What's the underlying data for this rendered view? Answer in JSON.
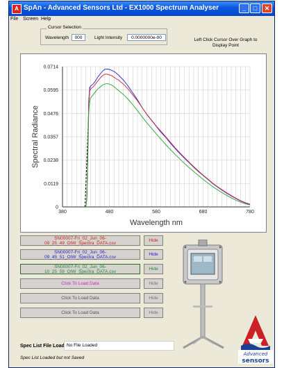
{
  "window": {
    "title": "SpAn - Advanced Sensors Ltd - EX1000 Spectrum Analyser",
    "app_icon_glyph": "A",
    "minimize_glyph": "_",
    "maximize_glyph": "□",
    "close_glyph": "✕",
    "titlebar_color": "#0b56df"
  },
  "menu": {
    "items": [
      "File",
      "Screen",
      "Help"
    ]
  },
  "cursor": {
    "group_label": "Cursor Selection",
    "wavelength_label": "Wavelength",
    "wavelength_value": "000",
    "intensity_label": "Light Intensity",
    "intensity_value": "0.0000000e-00",
    "hint": "Left Click Cursor Over Graph to Display Point"
  },
  "chart_data": {
    "type": "line",
    "xlabel": "Wavelength nm",
    "ylabel": "Spectral Radiance",
    "xlim": [
      380,
      780
    ],
    "ylim": [
      0,
      0.0714
    ],
    "x_ticks": [
      380,
      480,
      580,
      680,
      780
    ],
    "x_tick_labels": [
      "380",
      "480",
      "580",
      "680",
      "780"
    ],
    "y_ticks": [
      0,
      0.0119,
      0.0238,
      0.0357,
      0.0476,
      0.0595,
      0.0714
    ],
    "y_tick_labels": [
      "0",
      "0.0119",
      "0.0238",
      "0.0357",
      "0.0476",
      "0.0595",
      "0.0714"
    ],
    "grid": true,
    "x": [
      430,
      432,
      434,
      436,
      438,
      440,
      445,
      450,
      455,
      460,
      465,
      470,
      475,
      480,
      485,
      490,
      495,
      500,
      510,
      520,
      530,
      540,
      550,
      560,
      570,
      580,
      590,
      600,
      610,
      620,
      630,
      640,
      650,
      660,
      670,
      680,
      690,
      700,
      710,
      720,
      730,
      740,
      750,
      760,
      770,
      780
    ],
    "series": [
      {
        "color": "#3333cc",
        "values": [
          0.0,
          0.005,
          0.03,
          0.054,
          0.0605,
          0.0615,
          0.0625,
          0.064,
          0.066,
          0.0675,
          0.069,
          0.07,
          0.0702,
          0.07,
          0.0695,
          0.069,
          0.068,
          0.067,
          0.0645,
          0.0615,
          0.058,
          0.0545,
          0.0505,
          0.047,
          0.044,
          0.041,
          0.038,
          0.0355,
          0.0325,
          0.0298,
          0.0272,
          0.0248,
          0.0225,
          0.0202,
          0.018,
          0.016,
          0.014,
          0.012,
          0.0102,
          0.0086,
          0.007,
          0.0056,
          0.0042,
          0.003,
          0.002,
          0.0012
        ]
      },
      {
        "color": "#cc3344",
        "values": [
          0.0,
          0.005,
          0.029,
          0.053,
          0.059,
          0.06,
          0.061,
          0.0625,
          0.064,
          0.0655,
          0.0668,
          0.0675,
          0.0676,
          0.0672,
          0.0668,
          0.066,
          0.0652,
          0.0645,
          0.0625,
          0.06,
          0.057,
          0.054,
          0.0505,
          0.0472,
          0.0442,
          0.0412,
          0.0385,
          0.0358,
          0.033,
          0.0302,
          0.0276,
          0.0252,
          0.0228,
          0.0205,
          0.0183,
          0.0162,
          0.0142,
          0.0122,
          0.0104,
          0.0088,
          0.0072,
          0.0058,
          0.0044,
          0.0032,
          0.0022,
          0.0014
        ]
      },
      {
        "color": "#33aa44",
        "values": [
          0.0,
          0.004,
          0.025,
          0.048,
          0.054,
          0.0555,
          0.057,
          0.0585,
          0.06,
          0.061,
          0.062,
          0.0625,
          0.0628,
          0.0625,
          0.062,
          0.0612,
          0.0602,
          0.0592,
          0.0572,
          0.0548,
          0.052,
          0.049,
          0.0458,
          0.0428,
          0.04,
          0.0372,
          0.0345,
          0.0318,
          0.0292,
          0.0268,
          0.0245,
          0.0222,
          0.02,
          0.018,
          0.016,
          0.014,
          0.0122,
          0.0104,
          0.0088,
          0.0073,
          0.0059,
          0.0046,
          0.0034,
          0.0024,
          0.0016,
          0.001
        ]
      }
    ],
    "dashed_segment": {
      "x": [
        428,
        438
      ],
      "y": [
        0.0,
        0.061
      ],
      "color": "#111111"
    }
  },
  "files": [
    {
      "line1": "SN00007-Fri_02_Jun_06-",
      "line2": "09_25_49_OIW_Spectra_DATA.csv",
      "color": "#cc2222",
      "hide_label": "Hide",
      "hide_color": "#cc2222"
    },
    {
      "line1": "SN00007-Fri_02_Jun_06-",
      "line2": "09_45_51_OIW_Spectra_DATA.csv",
      "color": "#2222cc",
      "hide_label": "Hide",
      "hide_color": "#2222cc"
    },
    {
      "line1": "SN00007-Fri_02_Jun_06-",
      "line2": "10_25_59_OIW_Spectra_DATA.csv",
      "color": "#228833",
      "hide_label": "Hide",
      "hide_color": "#228833"
    },
    {
      "line1": "Click To Load Data",
      "line2": "",
      "color": "#cc22cc",
      "hide_label": "Hide",
      "hide_color": "#777777"
    },
    {
      "line1": "Click To Load Data",
      "line2": "",
      "color": "#555555",
      "hide_label": "Hide",
      "hide_color": "#777777"
    },
    {
      "line1": "Click To Load Data",
      "line2": "",
      "color": "#555555",
      "hide_label": "Hide",
      "hide_color": "#777777"
    }
  ],
  "spec_list": {
    "label": "Spec List File Loaded:",
    "value": "No File Loaded",
    "status": "Spec List Loaded but not Saved"
  },
  "logo": {
    "text": "Advanced sensors",
    "accent": "#cc1f26",
    "brand": "#1b3f93"
  }
}
